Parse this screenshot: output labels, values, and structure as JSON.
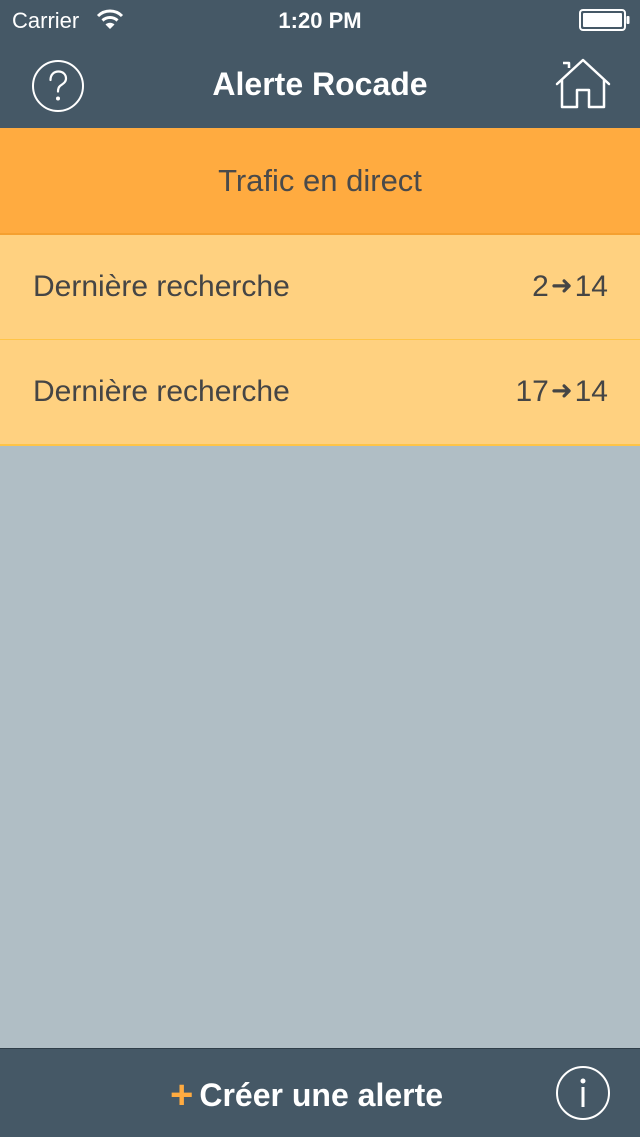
{
  "status_bar": {
    "carrier": "Carrier",
    "time": "1:20 PM",
    "wifi_icon": "wifi-icon",
    "battery_icon": "battery-icon"
  },
  "nav": {
    "title": "Alerte Rocade",
    "help_icon": "question-circle-icon",
    "home_icon": "home-icon"
  },
  "live_traffic": {
    "label": "Trafic en direct"
  },
  "history": [
    {
      "label": "Dernière recherche",
      "from": "2",
      "to": "14"
    },
    {
      "label": "Dernière recherche",
      "from": "17",
      "to": "14"
    }
  ],
  "footer": {
    "plus": "+",
    "create_label": "Créer une alerte",
    "info_icon": "info-circle-icon"
  },
  "colors": {
    "header_bg": "#455866",
    "accent_orange": "#ffab40",
    "row_bg": "#ffd180",
    "page_bg": "#b0bec5"
  }
}
